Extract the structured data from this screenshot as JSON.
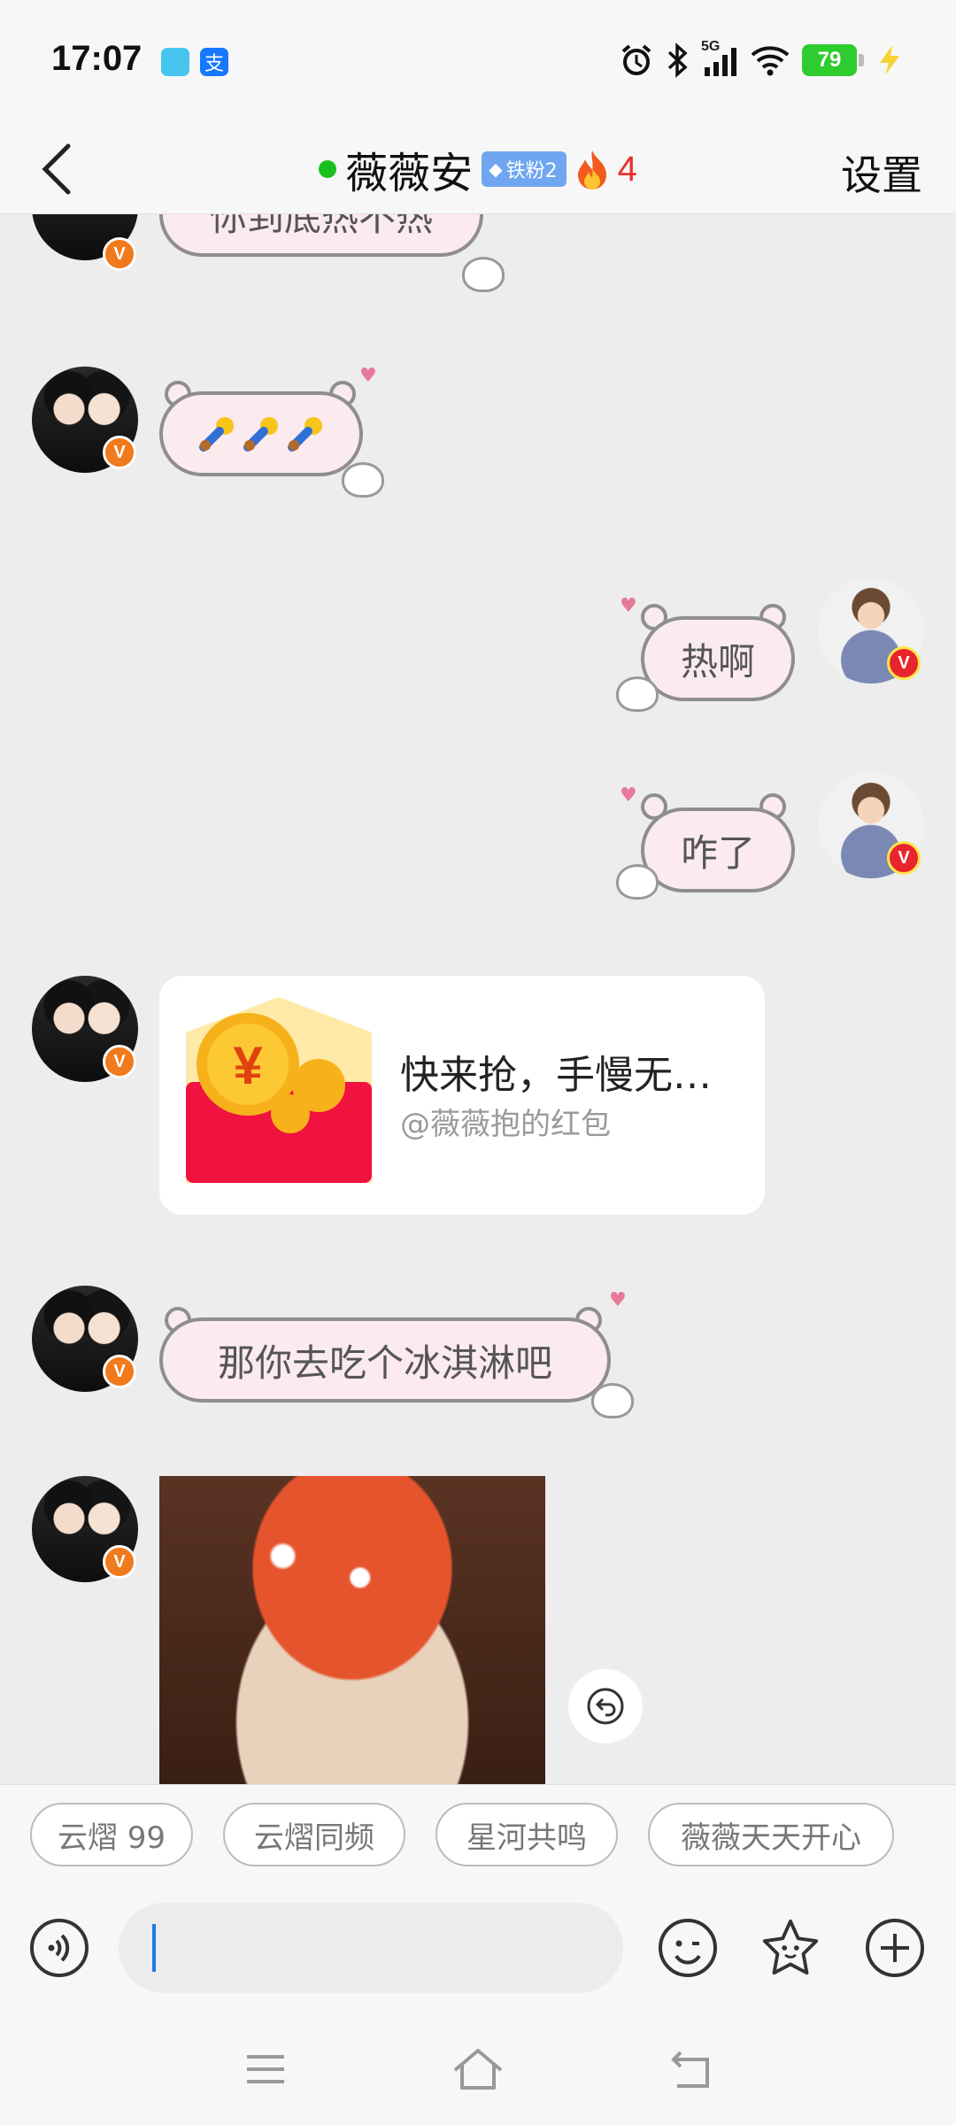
{
  "status_bar": {
    "time": "17:07",
    "battery": "79",
    "network": "5G"
  },
  "header": {
    "title": "薇薇安",
    "fan_badge": "铁粉2",
    "fire_count": "4",
    "settings_label": "设置"
  },
  "messages": [
    {
      "side": "left",
      "text": "你到底热不热"
    },
    {
      "side": "left",
      "text": "",
      "icon": "three-pacifier-emoji"
    },
    {
      "side": "right",
      "text": "热啊"
    },
    {
      "side": "right",
      "text": "咋了"
    },
    {
      "side": "left",
      "type": "red_packet",
      "title": "快来抢，手慢无…",
      "subtitle": "@薇薇抱的红包"
    },
    {
      "side": "left",
      "text": "那你去吃个冰淇淋吧"
    },
    {
      "side": "left",
      "type": "sticker",
      "icon": "mushroom-sticker"
    }
  ],
  "quick_replies": [
    "云熠 99",
    "云熠同频",
    "星河共鸣",
    "薇薇天天开心"
  ],
  "input": {
    "value": "",
    "placeholder": ""
  },
  "icons": {
    "voice": "voice-icon",
    "emoji": "emoji-icon",
    "sticker": "star-sticker-icon",
    "more": "plus-icon",
    "reply": "reply-arrow-icon"
  },
  "colors": {
    "online": "#19c01f",
    "fire": "#e8302e",
    "cursor": "#1f7be6",
    "bubble_fill": "#fbeaee",
    "red_packet": "#f0133f"
  }
}
